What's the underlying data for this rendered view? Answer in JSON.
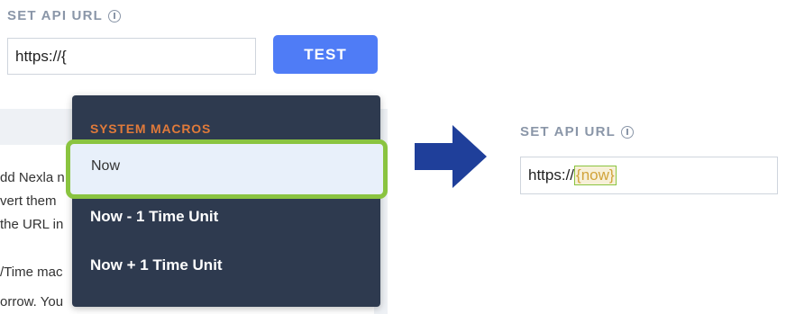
{
  "left_panel": {
    "label": "SET API URL",
    "input_value": "https://{",
    "test_button": "TEST",
    "background_lines": [
      "dd Nexla n",
      "vert them",
      "the URL in",
      "/Time mac",
      "orrow. You"
    ]
  },
  "dropdown": {
    "header": "SYSTEM MACROS",
    "items": [
      "Now",
      "Now - 1 Time Unit",
      "Now + 1 Time Unit"
    ],
    "highlighted_item": "Now"
  },
  "right_panel": {
    "label": "SET API URL",
    "input_prefix": "https://",
    "macro_tag": "{now}"
  },
  "colors": {
    "accent_button": "#4f7cf6",
    "dropdown_bg": "#2e3a4f",
    "header_orange": "#e07a3a",
    "highlight_green": "#8ac440",
    "arrow_blue": "#1f3f9a"
  },
  "icons": [
    "info-icon",
    "right-arrow-icon"
  ]
}
